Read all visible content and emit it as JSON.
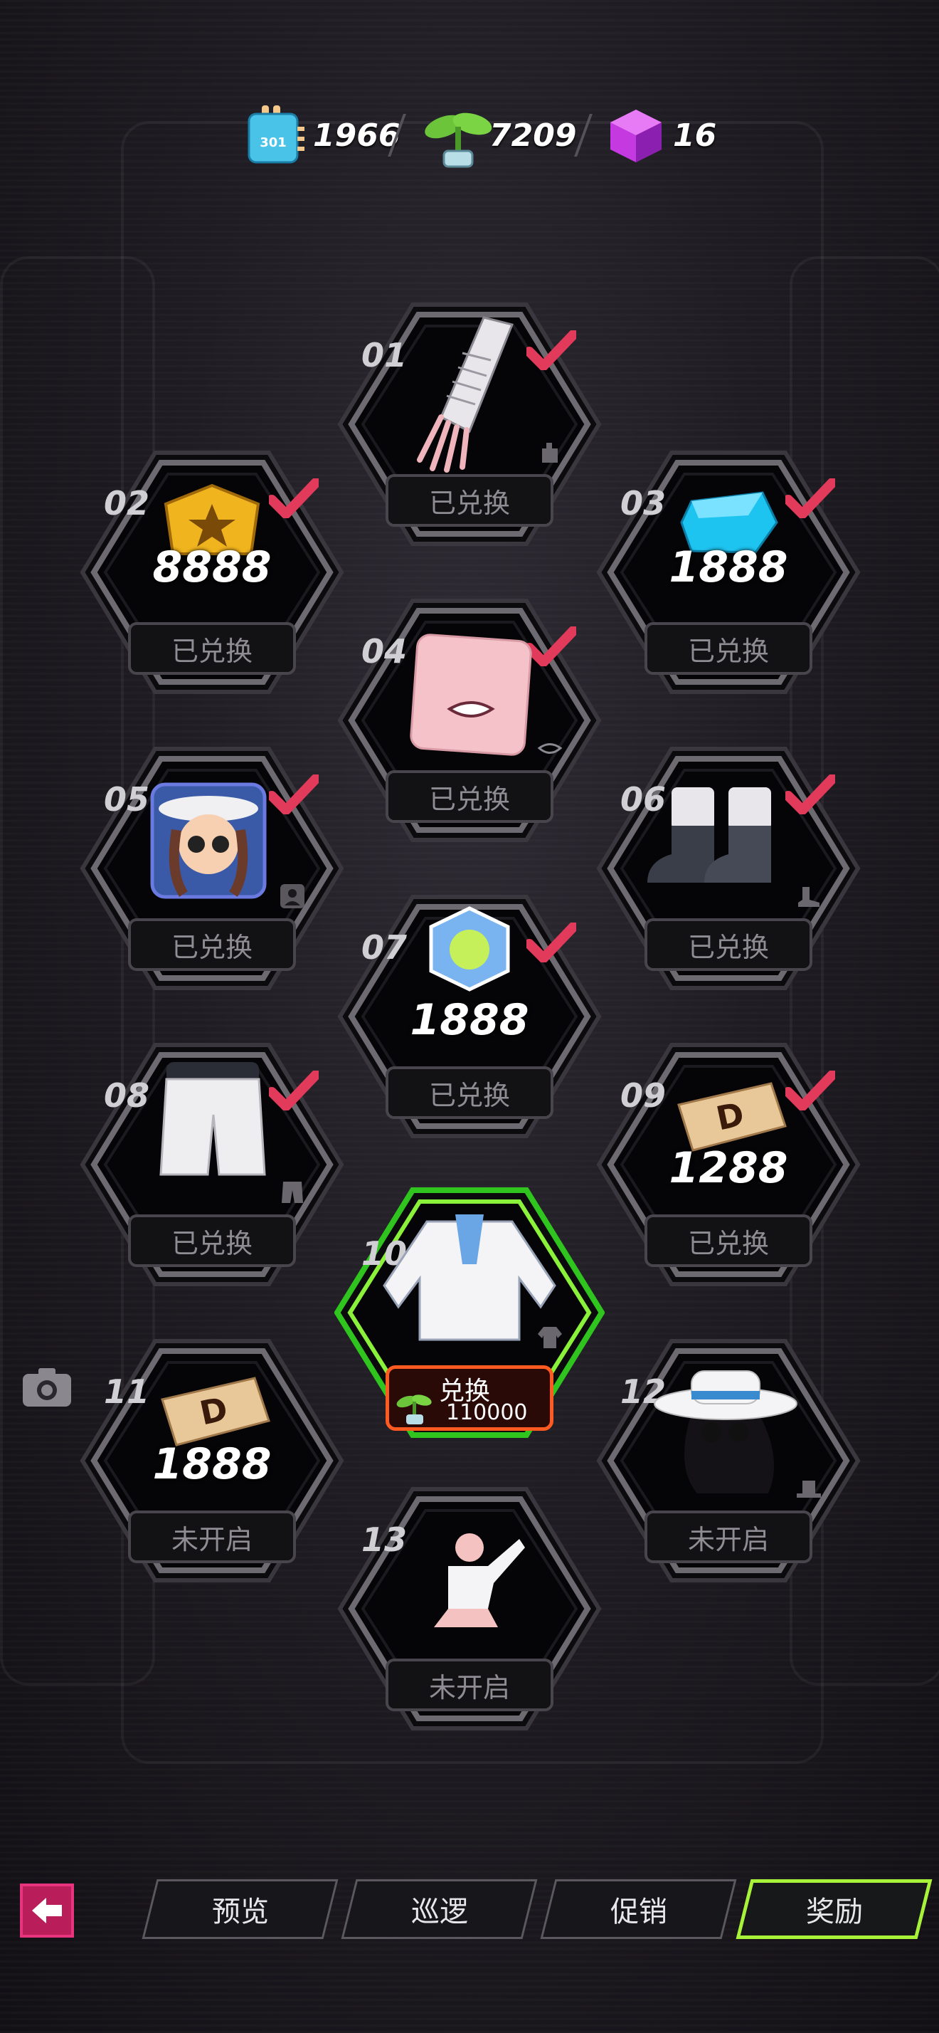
{
  "currencies": [
    {
      "icon": "ticket-301-icon",
      "badge": "301",
      "value": "1966"
    },
    {
      "icon": "sprout-icon",
      "value": "7209"
    },
    {
      "icon": "purple-cube-icon",
      "value": "16"
    }
  ],
  "rewards": [
    {
      "num": "01",
      "item": "lace-glove",
      "status": "已兑换",
      "redeemed": true
    },
    {
      "num": "02",
      "item": "gold-badge",
      "amount": "8888",
      "status": "已兑换",
      "redeemed": true
    },
    {
      "num": "03",
      "item": "blue-gem",
      "amount": "1888",
      "status": "已兑换",
      "redeemed": true
    },
    {
      "num": "04",
      "item": "mouth-face",
      "status": "已兑换",
      "redeemed": true
    },
    {
      "num": "05",
      "item": "avatar-portrait",
      "status": "已兑换",
      "redeemed": true
    },
    {
      "num": "06",
      "item": "boots",
      "status": "已兑换",
      "redeemed": true
    },
    {
      "num": "07",
      "item": "hexagon-ticket",
      "amount": "1888",
      "status": "已兑换",
      "redeemed": true
    },
    {
      "num": "08",
      "item": "white-pants",
      "status": "已兑换",
      "redeemed": true
    },
    {
      "num": "09",
      "item": "d-coupon",
      "amount": "1288",
      "status": "已兑换",
      "redeemed": true
    },
    {
      "num": "10",
      "item": "white-jacket",
      "status": "兑换",
      "cost": "110000",
      "redeemed": false,
      "active": true
    },
    {
      "num": "11",
      "item": "d-coupon",
      "amount": "1888",
      "status": "未开启",
      "redeemed": false
    },
    {
      "num": "12",
      "item": "white-hat-hair",
      "status": "未开启",
      "redeemed": false
    },
    {
      "num": "13",
      "item": "pose-emote",
      "status": "未开启",
      "redeemed": false
    }
  ],
  "tabs": [
    {
      "label": "预览",
      "active": false
    },
    {
      "label": "巡逻",
      "active": false
    },
    {
      "label": "促销",
      "active": false
    },
    {
      "label": "奖励",
      "active": true
    }
  ],
  "colors": {
    "accent_green": "#a8f23a",
    "check_red": "#e23a5a",
    "back_pink": "#e8337e",
    "redeem_orange": "#ff5a1f"
  }
}
